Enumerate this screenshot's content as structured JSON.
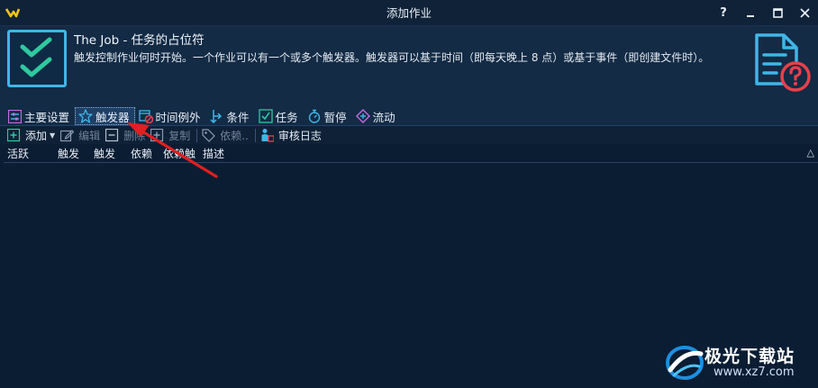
{
  "window": {
    "title": "添加作业",
    "controls": {
      "help": "?",
      "minimize": "▬",
      "maximize": "☐",
      "close": "✕"
    }
  },
  "header": {
    "job_title": "The Job - 任务的占位符",
    "description": "触发控制作业何时开始。一个作业可以有一个或多个触发器。触发器可以基于时间（即每天晚上 8 点）或基于事件（即创建文件时）。"
  },
  "tabs": [
    {
      "label": "主要设置",
      "icon": "settings-sliders-icon",
      "active": false
    },
    {
      "label": "触发器",
      "icon": "star-icon",
      "active": true
    },
    {
      "label": "时间例外",
      "icon": "calendar-exception-icon",
      "active": false
    },
    {
      "label": "条件",
      "icon": "branch-arrows-icon",
      "active": false
    },
    {
      "label": "任务",
      "icon": "checkbox-icon",
      "active": false
    },
    {
      "label": "暂停",
      "icon": "stopwatch-icon",
      "active": false
    },
    {
      "label": "流动",
      "icon": "flow-diamond-icon",
      "active": false
    }
  ],
  "toolbar": {
    "add": "添加",
    "edit": "编辑",
    "delete": "删除",
    "copy": "复制",
    "depends": "依赖..",
    "audit_log": "审核日志"
  },
  "grid": {
    "columns": [
      "活跃",
      "触发",
      "触发",
      "依赖",
      "依赖触",
      "描述"
    ],
    "rows": []
  },
  "watermark": {
    "name": "极光下载站",
    "url": "www.xz7.com"
  },
  "colors": {
    "accent": "#3fb6e8",
    "check": "#2fc9a0",
    "annotation": "#e02020",
    "background": "#0b1d33"
  }
}
